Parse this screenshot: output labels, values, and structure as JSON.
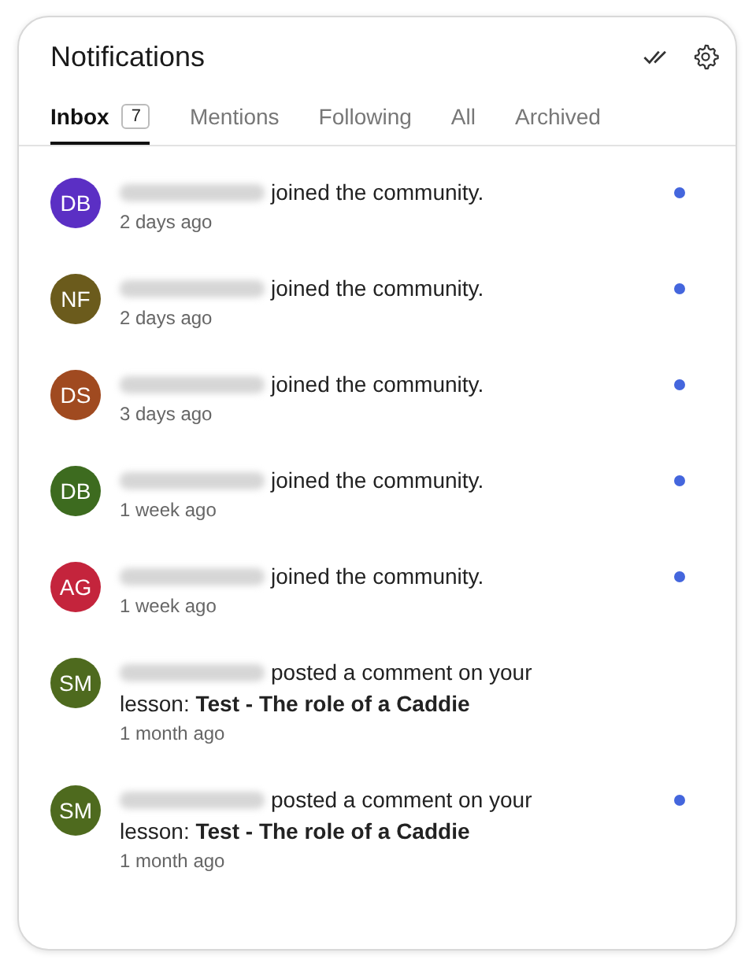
{
  "header": {
    "title": "Notifications"
  },
  "tabs": [
    {
      "label": "Inbox",
      "count": "7",
      "selected": true
    },
    {
      "label": "Mentions",
      "selected": false
    },
    {
      "label": "Following",
      "selected": false
    },
    {
      "label": "All",
      "selected": false
    },
    {
      "label": "Archived",
      "selected": false
    }
  ],
  "notifications": [
    {
      "initials": "DB",
      "color": "#5b2fc4",
      "redacted": true,
      "action": "joined the community.",
      "time": "2 days ago",
      "unread": true
    },
    {
      "initials": "NF",
      "color": "#6b5b1c",
      "redacted": true,
      "action": "joined the community.",
      "time": "2 days ago",
      "unread": true
    },
    {
      "initials": "DS",
      "color": "#a04a20",
      "redacted": true,
      "action": "joined the community.",
      "time": "3 days ago",
      "unread": true
    },
    {
      "initials": "DB",
      "color": "#3d6b1f",
      "redacted": true,
      "action": "joined the community.",
      "time": "1 week ago",
      "unread": true
    },
    {
      "initials": "AG",
      "color": "#c4243c",
      "redacted": true,
      "action": "joined the community.",
      "time": "1 week ago",
      "unread": true
    },
    {
      "initials": "SM",
      "color": "#4e6a1e",
      "redacted": true,
      "action": "posted a comment on your lesson: **Test - The role of a Caddie**",
      "time": "1 month ago",
      "unread": false
    },
    {
      "initials": "SM",
      "color": "#4e6a1e",
      "redacted": true,
      "action": "posted a comment on your lesson: **Test - The role of a Caddie**",
      "time": "1 month ago",
      "unread": true
    }
  ]
}
